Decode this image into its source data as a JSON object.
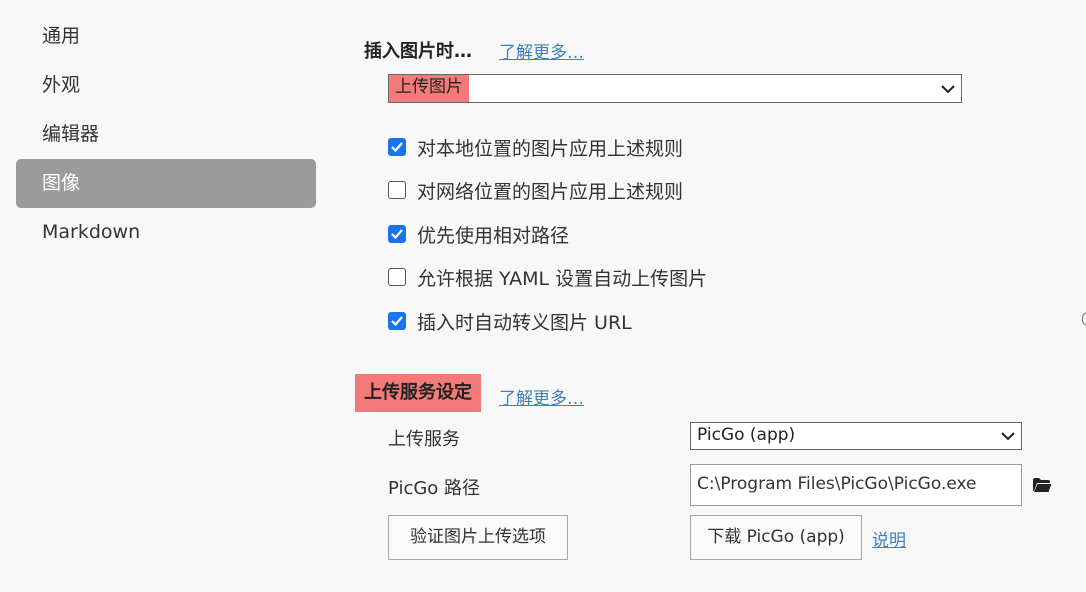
{
  "sidebar": {
    "items": [
      {
        "label": "通用"
      },
      {
        "label": "外观"
      },
      {
        "label": "编辑器"
      },
      {
        "label": "图像"
      },
      {
        "label": "Markdown"
      }
    ]
  },
  "insert_section": {
    "title": "插入图片时…",
    "learn_more": "了解更多…",
    "select_value": "上传图片",
    "checkboxes": [
      {
        "label": "对本地位置的图片应用上述规则",
        "checked": true
      },
      {
        "label": "对网络位置的图片应用上述规则",
        "checked": false
      },
      {
        "label": "优先使用相对路径",
        "checked": true
      },
      {
        "label": "允许根据 YAML 设置自动上传图片",
        "checked": false
      },
      {
        "label": "插入时自动转义图片 URL",
        "checked": true
      }
    ]
  },
  "upload_section": {
    "title": "上传服务设定",
    "learn_more": "了解更多…",
    "service_label": "上传服务",
    "service_value": "PicGo (app)",
    "path_label": "PicGo 路径",
    "path_value": "C:\\Program Files\\PicGo\\PicGo.exe",
    "verify_button": "验证图片上传选项",
    "download_button": "下载 PicGo (app)",
    "help_link": "说明"
  },
  "colors": {
    "highlight": "#f47a7a",
    "checkbox_checked": "#1a73e8",
    "link": "#3b7fc4",
    "sidebar_active": "#9b9b9b"
  },
  "icons": [
    "chevron-down-icon",
    "checkmark-icon",
    "folder-icon"
  ]
}
